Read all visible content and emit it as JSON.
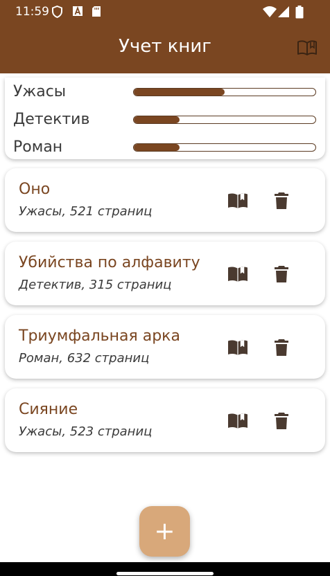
{
  "status_bar": {
    "time": "11:59",
    "icons": [
      "shield-icon",
      "a-font-icon",
      "sd-card-icon",
      "wifi-icon",
      "signal-icon",
      "battery-icon"
    ]
  },
  "app_bar": {
    "title": "Учет книг",
    "action_icon": "book-icon",
    "color": "#7a4621"
  },
  "stats": [
    {
      "label": "Ужасы",
      "progress": 0.5
    },
    {
      "label": "Детектив",
      "progress": 0.25
    },
    {
      "label": "Роман",
      "progress": 0.25
    }
  ],
  "books": [
    {
      "title": "Оно",
      "subtitle": "Ужасы, 521 страниц"
    },
    {
      "title": "Убийства по алфавиту",
      "subtitle": "Детектив, 315 страниц"
    },
    {
      "title": "Триумфальная арка",
      "subtitle": "Роман, 632 страниц"
    },
    {
      "title": "Сияние",
      "subtitle": "Ужасы, 523 страниц"
    }
  ],
  "fab": {
    "label": "+",
    "color": "#d8a87a"
  },
  "colors": {
    "accent": "#7a4621",
    "text": "#3a3a3a",
    "icon": "#4a3a30"
  }
}
